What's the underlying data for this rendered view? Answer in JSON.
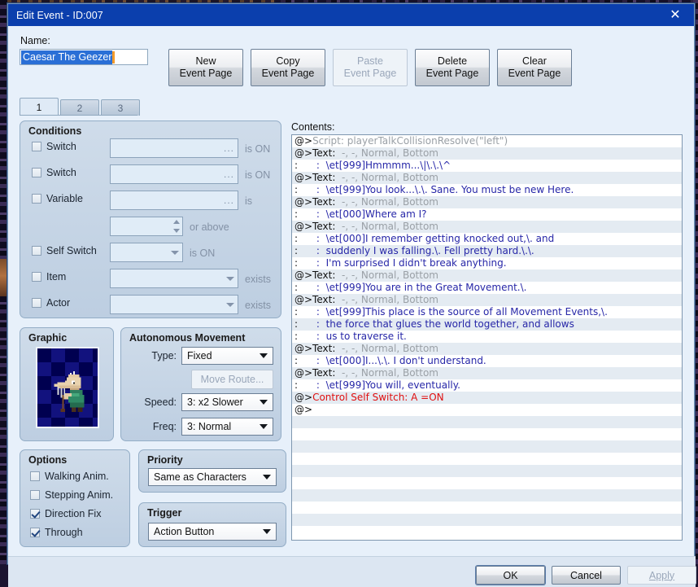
{
  "window": {
    "title": "Edit Event - ID:007",
    "close_icon": "close-icon"
  },
  "header": {
    "name_label": "Name:",
    "name_value": "Caesar The Geezer",
    "buttons": [
      {
        "label_line1": "New",
        "label_line2": "Event Page",
        "enabled": true
      },
      {
        "label_line1": "Copy",
        "label_line2": "Event Page",
        "enabled": true
      },
      {
        "label_line1": "Paste",
        "label_line2": "Event Page",
        "enabled": false
      },
      {
        "label_line1": "Delete",
        "label_line2": "Event Page",
        "enabled": true
      },
      {
        "label_line1": "Clear",
        "label_line2": "Event Page",
        "enabled": true
      }
    ]
  },
  "tabs": [
    {
      "label": "1",
      "active": true
    },
    {
      "label": "2",
      "active": false
    },
    {
      "label": "3",
      "active": false
    }
  ],
  "conditions": {
    "title": "Conditions",
    "rows": [
      {
        "label": "Switch",
        "checked": false,
        "value": "",
        "suffix": "is ON",
        "picker": "..."
      },
      {
        "label": "Switch",
        "checked": false,
        "value": "",
        "suffix": "is ON",
        "picker": "..."
      },
      {
        "label": "Variable",
        "checked": false,
        "value": "",
        "suffix": "is",
        "picker": "..."
      },
      {
        "label": "",
        "checked": null,
        "value": "",
        "suffix": "or above",
        "picker": "spinner"
      },
      {
        "label": "Self Switch",
        "checked": false,
        "value": "",
        "suffix": "is ON",
        "picker": "dropdown"
      },
      {
        "label": "Item",
        "checked": false,
        "value": "",
        "suffix": "exists",
        "picker": "dropdown"
      },
      {
        "label": "Actor",
        "checked": false,
        "value": "",
        "suffix": "exists",
        "picker": "dropdown"
      }
    ]
  },
  "graphic": {
    "title": "Graphic"
  },
  "autonomous": {
    "title": "Autonomous Movement",
    "type_label": "Type:",
    "type_value": "Fixed",
    "move_route_label": "Move Route...",
    "move_route_enabled": false,
    "speed_label": "Speed:",
    "speed_value": "3: x2 Slower",
    "freq_label": "Freq:",
    "freq_value": "3: Normal"
  },
  "options": {
    "title": "Options",
    "items": [
      {
        "label": "Walking Anim.",
        "checked": false
      },
      {
        "label": "Stepping Anim.",
        "checked": false
      },
      {
        "label": "Direction Fix",
        "checked": true
      },
      {
        "label": "Through",
        "checked": true
      }
    ]
  },
  "priority": {
    "title": "Priority",
    "value": "Same as Characters"
  },
  "trigger": {
    "title": "Trigger",
    "value": "Action Button"
  },
  "contents": {
    "label": "Contents:",
    "rows": [
      {
        "prefix": "@>",
        "kind": "script",
        "head": "Script: ",
        "text": "playerTalkCollisionResolve(\"left\")"
      },
      {
        "prefix": "@>",
        "kind": "cmd",
        "head": "Text: ",
        "text": "-, -, Normal, Bottom"
      },
      {
        "prefix": ":",
        "kind": "line",
        "head": "",
        "text": ":  \\et[999]Hmmmm...\\|\\.\\.\\^"
      },
      {
        "prefix": "@>",
        "kind": "cmd",
        "head": "Text: ",
        "text": "-, -, Normal, Bottom"
      },
      {
        "prefix": ":",
        "kind": "line",
        "head": "",
        "text": ":  \\et[999]You look...\\.\\. Sane. You must be new Here."
      },
      {
        "prefix": "@>",
        "kind": "cmd",
        "head": "Text: ",
        "text": "-, -, Normal, Bottom"
      },
      {
        "prefix": ":",
        "kind": "line",
        "head": "",
        "text": ":  \\et[000]Where am I?"
      },
      {
        "prefix": "@>",
        "kind": "cmd",
        "head": "Text: ",
        "text": "-, -, Normal, Bottom"
      },
      {
        "prefix": ":",
        "kind": "line",
        "head": "",
        "text": ":  \\et[000]I remember getting knocked out,\\. and"
      },
      {
        "prefix": ":",
        "kind": "line",
        "head": "",
        "text": ":  suddenly I was falling.\\. Fell pretty hard.\\.\\."
      },
      {
        "prefix": ":",
        "kind": "line",
        "head": "",
        "text": ":  I'm surprised I didn't break anything."
      },
      {
        "prefix": "@>",
        "kind": "cmd",
        "head": "Text: ",
        "text": "-, -, Normal, Bottom"
      },
      {
        "prefix": ":",
        "kind": "line",
        "head": "",
        "text": ":  \\et[999]You are in the Great Movement.\\."
      },
      {
        "prefix": "@>",
        "kind": "cmd",
        "head": "Text: ",
        "text": "-, -, Normal, Bottom"
      },
      {
        "prefix": ":",
        "kind": "line",
        "head": "",
        "text": ":  \\et[999]This place is the source of all Movement Events,\\."
      },
      {
        "prefix": ":",
        "kind": "line",
        "head": "",
        "text": ":  the force that glues the world together, and allows"
      },
      {
        "prefix": ":",
        "kind": "line",
        "head": "",
        "text": ":  us to traverse it."
      },
      {
        "prefix": "@>",
        "kind": "cmd",
        "head": "Text: ",
        "text": "-, -, Normal, Bottom"
      },
      {
        "prefix": ":",
        "kind": "line",
        "head": "",
        "text": ":  \\et[000]I...\\.\\. I don't understand."
      },
      {
        "prefix": "@>",
        "kind": "cmd",
        "head": "Text: ",
        "text": "-, -, Normal, Bottom"
      },
      {
        "prefix": ":",
        "kind": "line",
        "head": "",
        "text": ":  \\et[999]You will, eventually."
      },
      {
        "prefix": "@>",
        "kind": "selfswitch",
        "head": "",
        "text": "Control Self Switch: A =ON"
      },
      {
        "prefix": "@>",
        "kind": "empty",
        "head": "",
        "text": ""
      }
    ],
    "blank_rows": 10
  },
  "footer": {
    "ok_label": "OK",
    "cancel_label": "Cancel",
    "apply_label": "Apply",
    "apply_enabled": false
  },
  "colors": {
    "titlebar": "#0b3fad",
    "selection": "#2a6fd6",
    "caret": "#f59b2a",
    "list_text": "#2727a8",
    "list_gray": "#9aa0a6",
    "list_red": "#e01010",
    "panel": "#e7f0fa",
    "group": "#c6d5e6"
  }
}
